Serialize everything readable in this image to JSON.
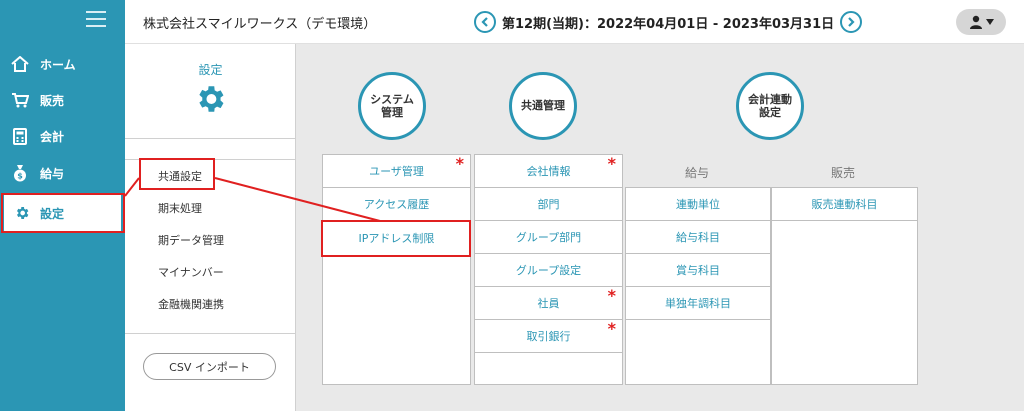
{
  "sidebar": {
    "items": [
      {
        "label": "ホーム",
        "icon": "home-icon"
      },
      {
        "label": "販売",
        "icon": "cart-icon"
      },
      {
        "label": "会計",
        "icon": "calculator-icon"
      },
      {
        "label": "給与",
        "icon": "money-bag-icon"
      },
      {
        "label": "設定",
        "icon": "gear-icon"
      }
    ]
  },
  "header": {
    "company": "株式会社スマイルワークス（デモ環境）",
    "period": "第12期(当期)：2022年04月01日 - 2023年03月31日"
  },
  "submenu": {
    "title": "設定",
    "items": [
      "共通設定",
      "期末処理",
      "期データ管理",
      "マイナンバー",
      "金融機関連携"
    ],
    "csv_button": "CSV インポート"
  },
  "categories": {
    "system": "システム\n管理",
    "common": "共通管理",
    "accounting": "会計連動\n設定"
  },
  "system_column": [
    "ユーザ管理",
    "アクセス履歴",
    "IPアドレス制限"
  ],
  "common_column": [
    "会社情報",
    "部門",
    "グループ部門",
    "グループ設定",
    "社員",
    "取引銀行"
  ],
  "payroll": {
    "header": "給与",
    "items": [
      "連動単位",
      "給与科目",
      "賞与科目",
      "単独年調科目"
    ]
  },
  "sales": {
    "header": "販売",
    "items": [
      "販売連動科目"
    ]
  },
  "required_mark": "*",
  "colors": {
    "accent": "#2b96b4",
    "highlight": "#e02020"
  }
}
